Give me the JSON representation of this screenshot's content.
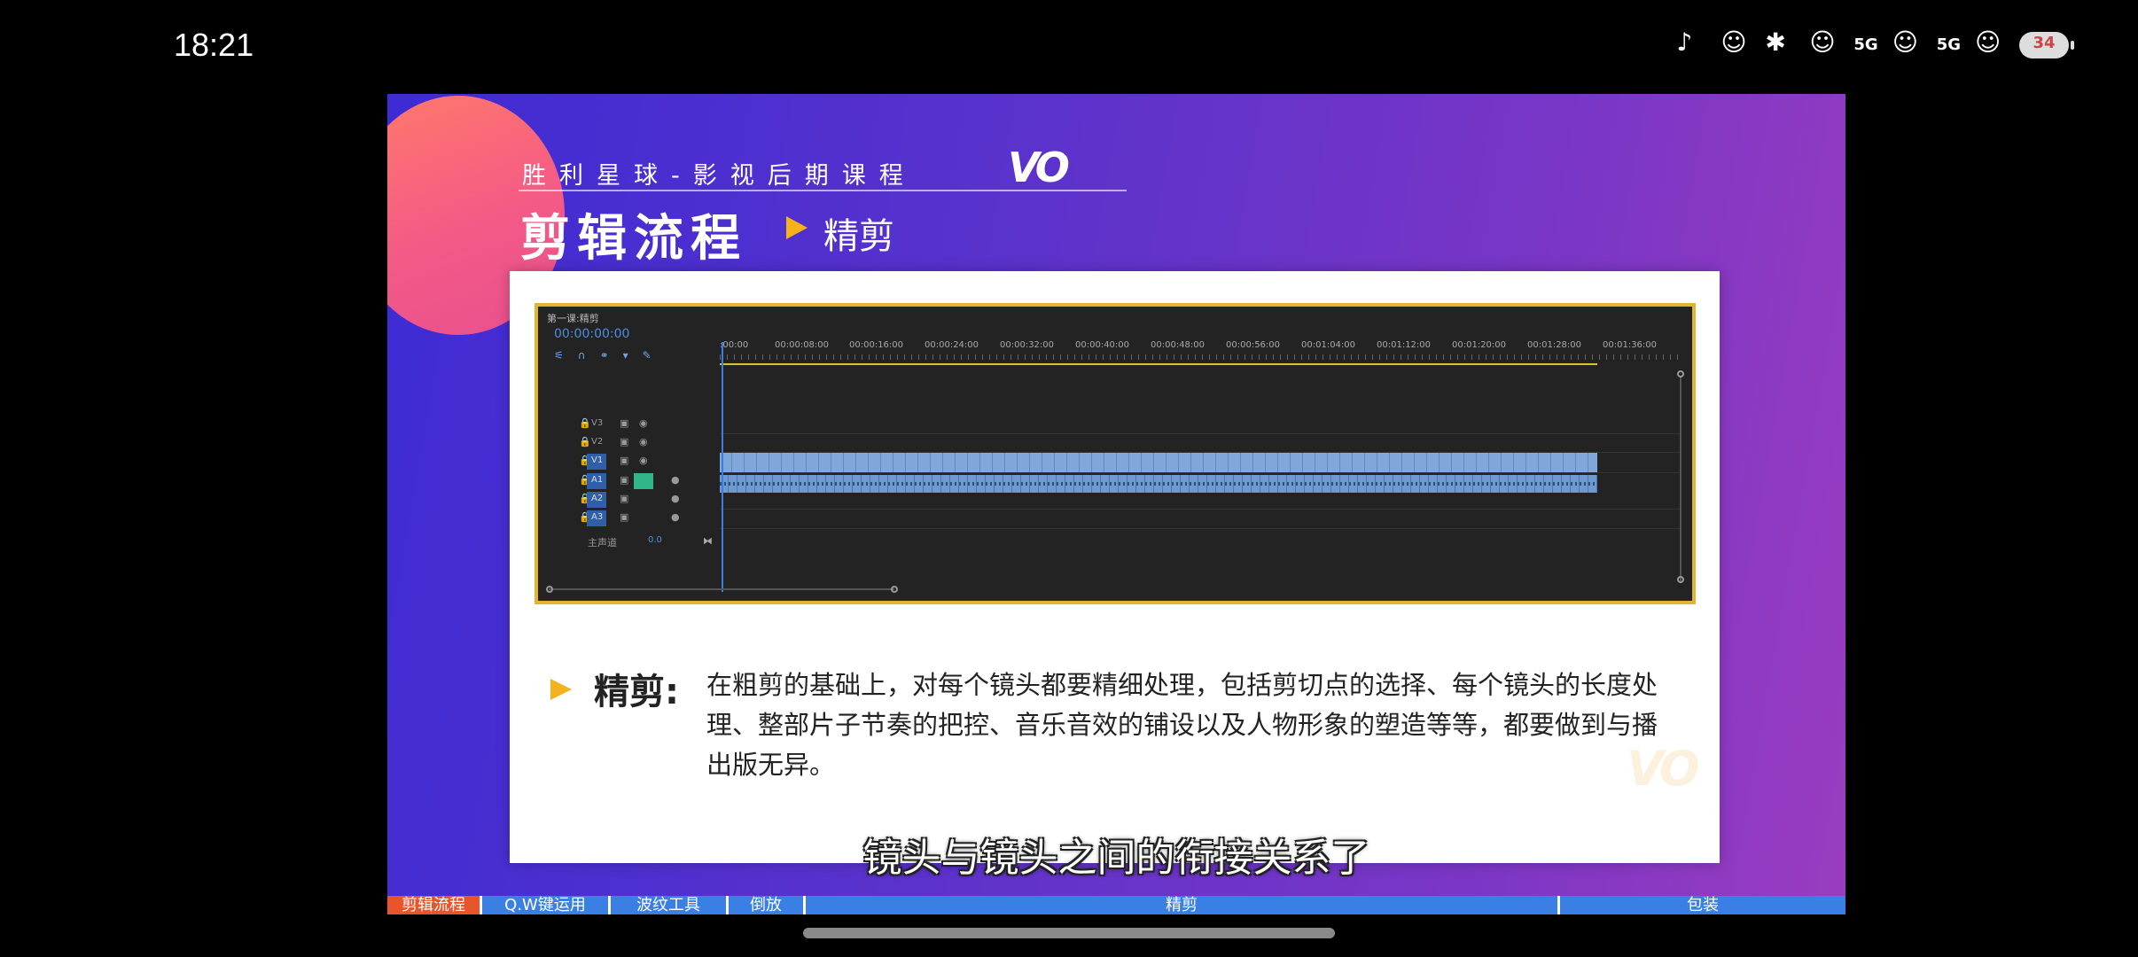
{
  "status_bar": {
    "time": "18:21",
    "network_1": "5G",
    "network_2": "5G",
    "battery": "34",
    "icons": [
      "tiktok-icon",
      "app-icon",
      "bluetooth-icon",
      "hd-icon",
      "app-icon",
      "app-icon",
      "battery-icon"
    ]
  },
  "slide": {
    "subtitle_header": "胜利星球-影视后期课程",
    "logo_text": "VO",
    "main_title": "剪辑流程",
    "section": "精剪",
    "editor": {
      "sequence_tab": "第一课:精剪",
      "timecode": "00:00:00:00",
      "ruler_ticks": [
        ":00:00",
        "00:00:08:00",
        "00:00:16:00",
        "00:00:24:00",
        "00:00:32:00",
        "00:00:40:00",
        "00:00:48:00",
        "00:00:56:00",
        "00:01:04:00",
        "00:01:12:00",
        "00:01:20:00",
        "00:01:28:00",
        "00:01:36:00"
      ],
      "tracks": [
        {
          "id": "V3"
        },
        {
          "id": "V2"
        },
        {
          "id": "V1"
        },
        {
          "id": "A1"
        },
        {
          "id": "A2"
        },
        {
          "id": "A3"
        }
      ],
      "master_label": "主声道",
      "master_value": "0.0"
    },
    "term": "精剪:",
    "description": "在粗剪的基础上，对每个镜头都要精细处理，包括剪切点的选择、每个镜头的长度处理、整部片子节奏的把控、音乐音效的铺设以及人物形象的塑造等等，都要做到与播出版无异。",
    "video_subtitle": "镜头与镜头之间的衔接关系了"
  },
  "chapters": [
    {
      "label": "剪辑流程",
      "active": true
    },
    {
      "label": "Q.W键运用",
      "active": false
    },
    {
      "label": "波纹工具",
      "active": false
    },
    {
      "label": "倒放",
      "active": false
    },
    {
      "label": "精剪",
      "active": false
    },
    {
      "label": "包装",
      "active": false
    }
  ],
  "colors": {
    "accent_yellow": "#f4b21d",
    "chapter_active": "#e7552c",
    "chapter_bar": "#3a7fe4"
  }
}
